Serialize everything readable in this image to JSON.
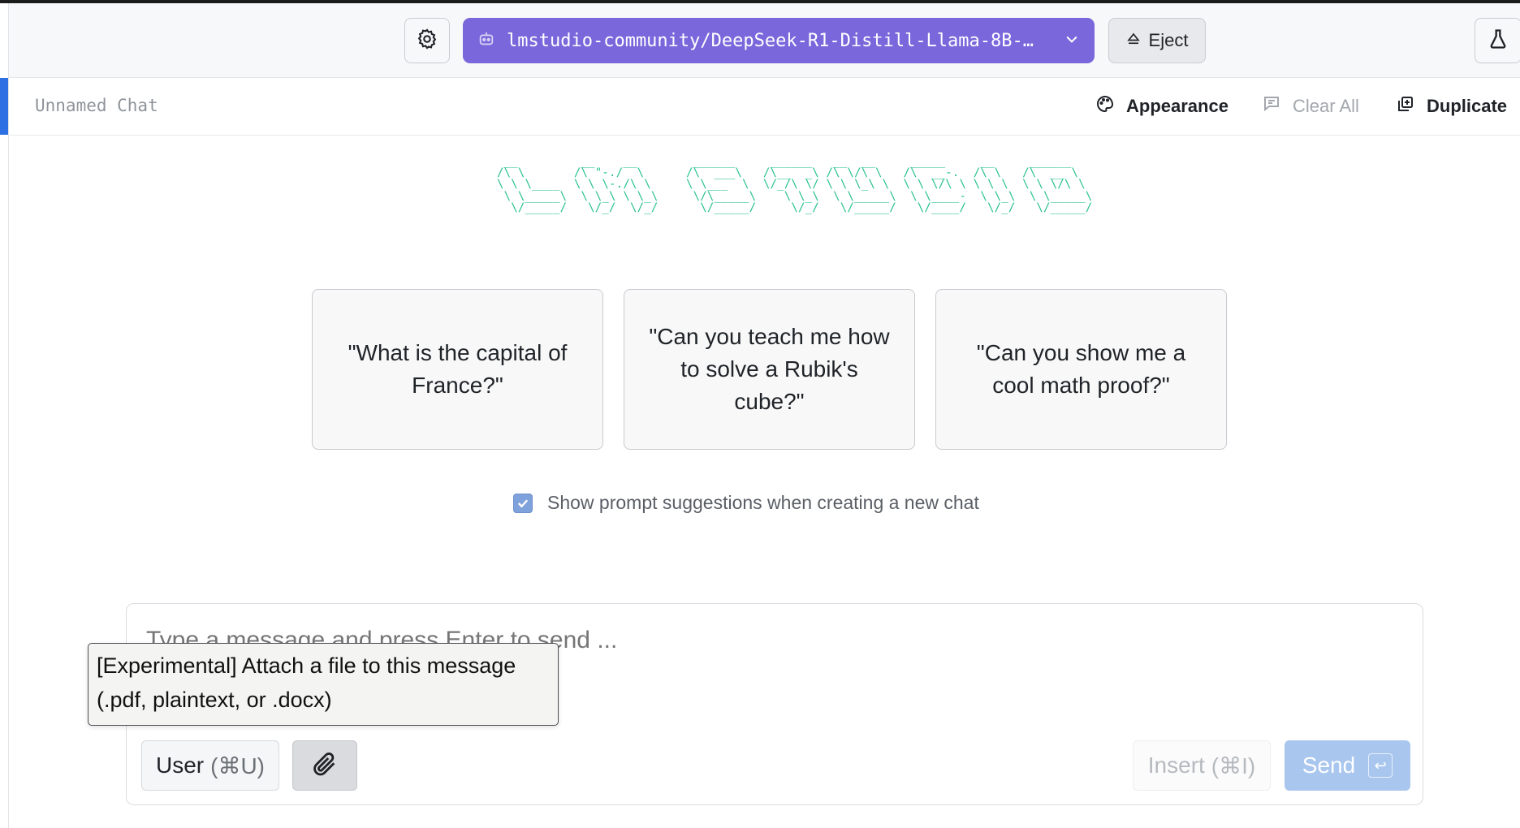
{
  "header": {
    "model_name": "lmstudio-community/DeepSeek-R1-Distill-Llama-8B-…",
    "eject_label": "Eject",
    "model_bg_color": "#7967db"
  },
  "chat": {
    "title": "Unnamed Chat",
    "actions": {
      "appearance": "Appearance",
      "clear_all": "Clear All",
      "duplicate": "Duplicate"
    }
  },
  "logo_ascii": " __         __    __        ______     ______   __  __     _____     __     ______\n/\\ \\       /\\ \"-./  \\      /\\  ___\\   /\\__  _\\ /\\ \\/\\ \\   /\\  __-.  /\\ \\   /\\  __ \\\n\\ \\ \\____  \\ \\ \\-./\\ \\     \\ \\___  \\  \\/_/\\ \\/ \\ \\ \\_\\ \\  \\ \\ \\/\\ \\ \\ \\ \\  \\ \\ \\/\\ \\\n \\ \\_____\\  \\ \\_\\ \\ \\_\\     \\/\\_____\\    \\ \\_\\  \\ \\_____\\  \\ \\____-  \\ \\_\\  \\ \\_____\\\n  \\/_____/   \\/_/  \\/_/      \\/_____/     \\/_/   \\/_____/   \\/____/   \\/_/   \\/_____/",
  "suggestions": [
    "\"What is the capital of France?\"",
    "\"Can you teach me how to solve a Rubik's cube?\"",
    "\"Can you show me a cool math proof?\""
  ],
  "show_suggestions": {
    "label": "Show prompt suggestions when creating a new chat",
    "checked": true
  },
  "composer": {
    "placeholder": "Type a message and press Enter to send ...",
    "role_label": "User",
    "role_shortcut": "(⌘U)",
    "insert_label": "Insert",
    "insert_shortcut": "(⌘I)",
    "send_label": "Send",
    "send_key": "↩"
  },
  "tooltip": {
    "line1": "[Experimental] Attach a file to this message",
    "line2": "(.pdf, plaintext, or .docx)"
  }
}
